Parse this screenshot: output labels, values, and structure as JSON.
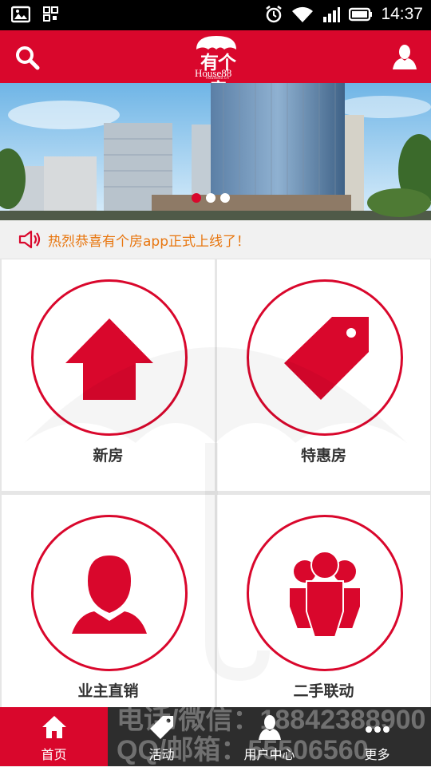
{
  "status_bar": {
    "time": "14:37",
    "icons": [
      "image-icon",
      "qr-code-icon",
      "alarm-icon",
      "wifi-icon",
      "signal-icon",
      "battery-icon"
    ]
  },
  "header": {
    "logo_cn": "有个房",
    "logo_en": "House88",
    "logo_domain": "house88.cn",
    "search_icon": "search-icon",
    "user_icon": "user-icon",
    "brand_color": "#d9072c"
  },
  "banner": {
    "slide_count": 3,
    "active_slide": 1
  },
  "notice": {
    "icon": "speaker-icon",
    "text": "热烈恭喜有个房app正式上线了！",
    "color": "#e8760f"
  },
  "menu": [
    {
      "label": "新房",
      "icon": "house-icon"
    },
    {
      "label": "特惠房",
      "icon": "price-tag-icon"
    },
    {
      "label": "业主直销",
      "icon": "person-icon"
    },
    {
      "label": "二手联动",
      "icon": "group-icon"
    }
  ],
  "tabbar": {
    "tabs": [
      {
        "label": "首页",
        "icon": "home-icon",
        "active": true
      },
      {
        "label": "活动",
        "icon": "tag-icon",
        "active": false
      },
      {
        "label": "用户中心",
        "icon": "user-icon",
        "active": false
      },
      {
        "label": "更多",
        "icon": "more-dots-icon",
        "active": false
      }
    ],
    "overlay_line1": "电话/微信：18842388900",
    "overlay_line2": "QQ/邮箱：55506560"
  }
}
